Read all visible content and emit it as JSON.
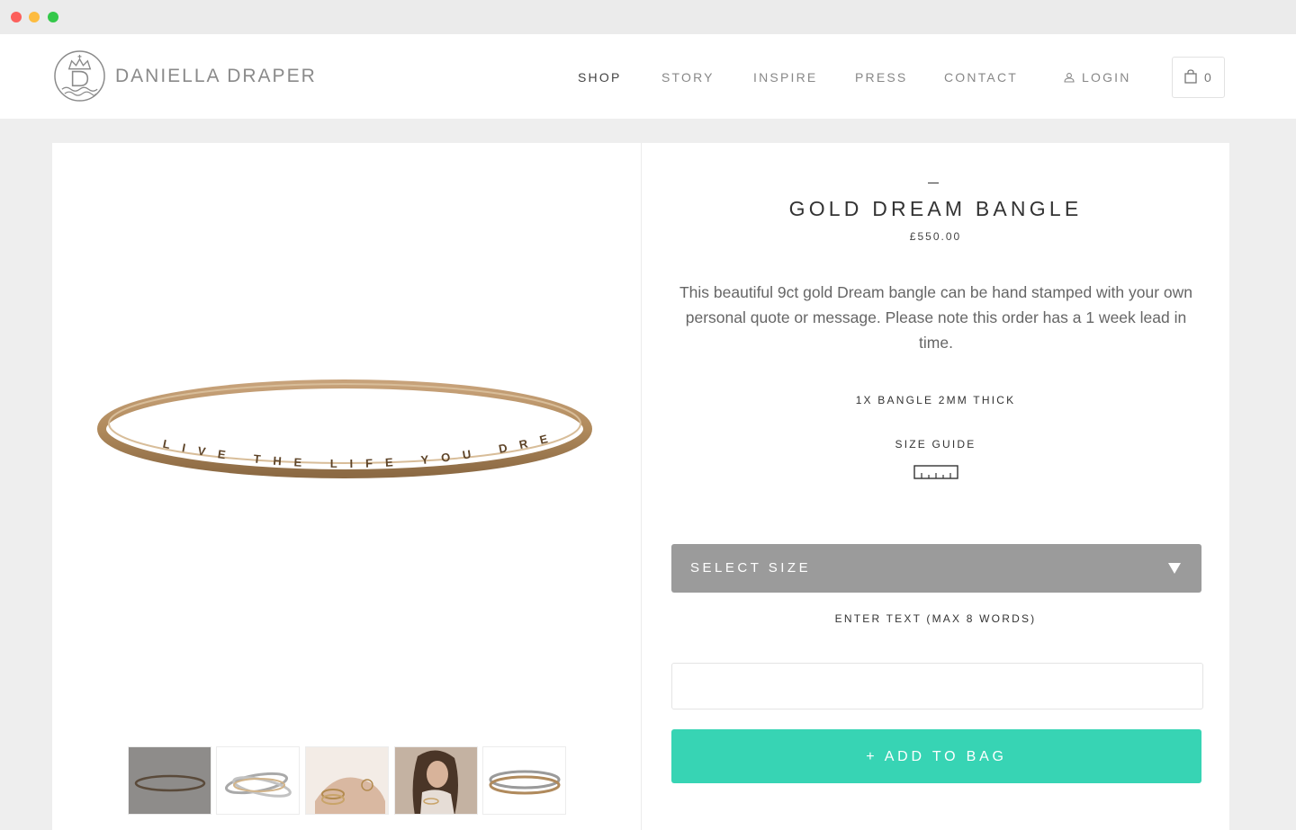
{
  "window": {
    "controls": [
      "close",
      "minimize",
      "maximize"
    ]
  },
  "brand": {
    "name": "DANIELLA DRAPER",
    "logo_icon": "crown-d-wave-logo"
  },
  "nav": {
    "items": [
      {
        "label": "SHOP",
        "active": true
      },
      {
        "label": "STORY",
        "active": false
      },
      {
        "label": "INSPIRE",
        "active": false
      },
      {
        "label": "PRESS",
        "active": false
      },
      {
        "label": "CONTACT",
        "active": false
      }
    ],
    "login": {
      "label": "LOGIN",
      "icon": "user-icon"
    },
    "cart": {
      "count": "0",
      "icon": "shopping-bag-icon"
    }
  },
  "product": {
    "dash": "–",
    "title": "GOLD DREAM BANGLE",
    "price": "£550.00",
    "description": "This beautiful 9ct gold Dream bangle can be hand stamped with your own personal quote or message. Please note this order has a 1 week lead in time.",
    "variant": "1X BANGLE 2MM THICK",
    "size_guide": {
      "label": "SIZE GUIDE",
      "icon": "ruler-icon"
    },
    "engraving": "LIVE THE LIFE YOU DREAM",
    "select": {
      "label": "SELECT SIZE",
      "icon": "triangle-down-icon"
    },
    "text_field": {
      "label": "ENTER TEXT (MAX 8 WORDS)",
      "value": "",
      "placeholder": ""
    },
    "add_button": {
      "label": "+ ADD TO BAG"
    },
    "thumbnails": [
      {
        "name": "thumb-gold-bangle"
      },
      {
        "name": "thumb-silver-bangles"
      },
      {
        "name": "thumb-hand-bangles"
      },
      {
        "name": "thumb-model"
      },
      {
        "name": "thumb-two-bangles"
      }
    ]
  },
  "colors": {
    "accent": "#37d4b4",
    "select_bg": "#9b9b9b",
    "page_bg": "#eeeeee",
    "gold": "#b08a5c"
  }
}
